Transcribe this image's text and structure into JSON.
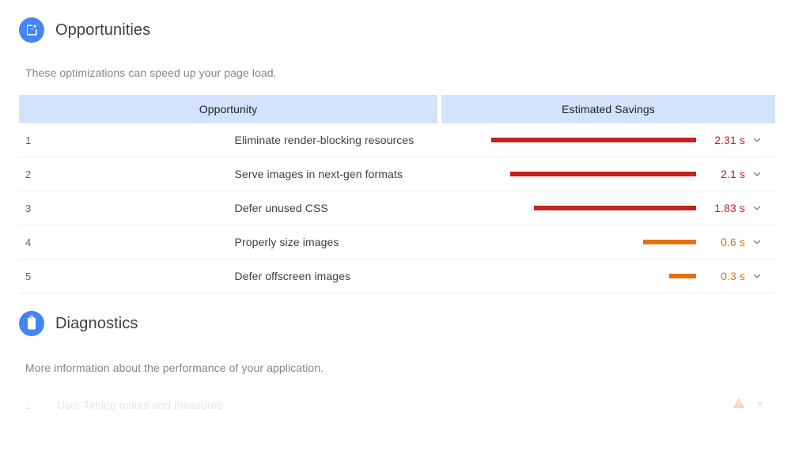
{
  "opportunities": {
    "icon": "opportunity-sparkle-icon",
    "title": "Opportunities",
    "description": "These optimizations can speed up your page load.",
    "table": {
      "headers": {
        "opportunity": "Opportunity",
        "savings": "Estimated Savings"
      },
      "rows": [
        {
          "index": "1",
          "title": "Eliminate render-blocking resources",
          "savings": "2.31 s",
          "value": 2.31,
          "severity": "error",
          "color": "#c5221f",
          "chevron": "chevron-down-icon"
        },
        {
          "index": "2",
          "title": "Serve images in next-gen formats",
          "savings": "2.1 s",
          "value": 2.1,
          "severity": "error",
          "color": "#c5221f",
          "chevron": "chevron-down-icon"
        },
        {
          "index": "3",
          "title": "Defer unused CSS",
          "savings": "1.83 s",
          "value": 1.83,
          "severity": "error",
          "color": "#c5221f",
          "chevron": "chevron-down-icon"
        },
        {
          "index": "4",
          "title": "Properly size images",
          "savings": "0.6 s",
          "value": 0.6,
          "severity": "average",
          "color": "#e8710a",
          "chevron": "chevron-down-icon"
        },
        {
          "index": "5",
          "title": "Defer offscreen images",
          "savings": "0.3 s",
          "value": 0.3,
          "severity": "average",
          "color": "#e8710a",
          "chevron": "chevron-down-icon"
        }
      ]
    }
  },
  "diagnostics": {
    "icon": "clipboard-icon",
    "title": "Diagnostics",
    "description": "More information about the performance of your application.",
    "rows": [
      {
        "index": "1",
        "title": "User Timing marks and measures",
        "badge": "warning-triangle-icon",
        "chevron": "chevron-down-icon"
      }
    ]
  },
  "theme": {
    "accent_blue": "#4285f4",
    "header_bg": "#d3e3fd",
    "error_red": "#c5221f",
    "average_orange": "#e8710a",
    "text_primary": "#3c4043",
    "text_secondary": "#80868b",
    "divider": "#ededed"
  },
  "chart_data": {
    "type": "bar",
    "title": "Estimated Savings",
    "xlabel": "Seconds",
    "ylabel": "Opportunity",
    "categories": [
      "Eliminate render-blocking resources",
      "Serve images in next-gen formats",
      "Defer unused CSS",
      "Properly size images",
      "Defer offscreen images"
    ],
    "values": [
      2.31,
      2.1,
      1.83,
      0.6,
      0.3
    ],
    "labels": [
      "2.31 s",
      "2.1 s",
      "1.83 s",
      "0.6 s",
      "0.3 s"
    ],
    "colors": [
      "#c5221f",
      "#c5221f",
      "#c5221f",
      "#e8710a",
      "#e8710a"
    ],
    "xlim": [
      0,
      2.31
    ],
    "grid": false,
    "legend": null,
    "orientation": "horizontal-right-aligned"
  }
}
